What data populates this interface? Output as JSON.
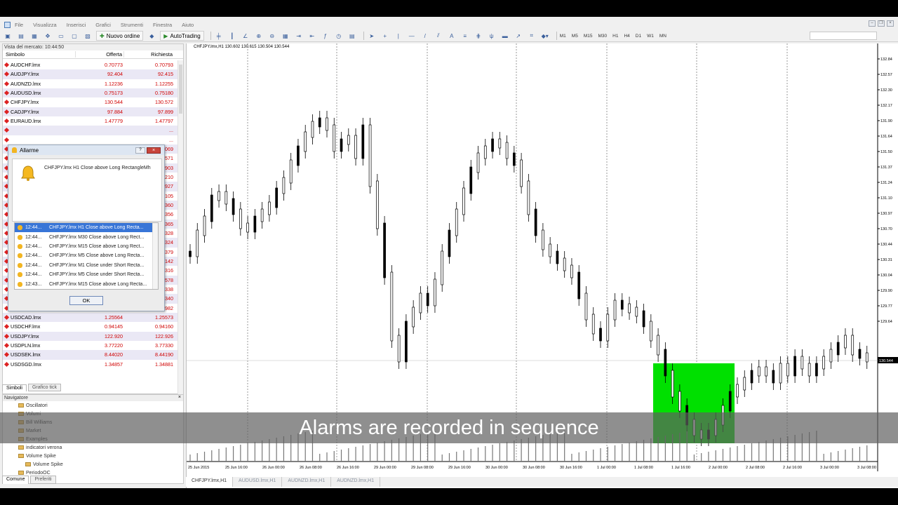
{
  "menu": [
    "File",
    "Visualizza",
    "Inserisci",
    "Grafici",
    "Strumenti",
    "Finestra",
    "Aiuto"
  ],
  "toolbar": {
    "new_order": "Nuovo ordine",
    "autotrading": "AutoTrading",
    "timeframes": [
      "M1",
      "M5",
      "M15",
      "M30",
      "H1",
      "H4",
      "D1",
      "W1",
      "MN"
    ]
  },
  "market_watch": {
    "title": "Vista del mercato: 10:44:50",
    "col_symbol": "Simbolo",
    "col_bid": "Offerta",
    "col_ask": "Richiesta",
    "rows": [
      [
        "AUDCHF.lmx",
        "0.70773",
        "0.70793"
      ],
      [
        "AUDJPY.lmx",
        "92.404",
        "92.415"
      ],
      [
        "AUDNZD.lmx",
        "1.12236",
        "1.12255"
      ],
      [
        "AUDUSD.lmx",
        "0.75173",
        "0.75180"
      ],
      [
        "CHFJPY.lmx",
        "130.544",
        "130.572"
      ],
      [
        "CADJPY.lmx",
        "97.884",
        "97.899"
      ],
      [
        "EURAUD.lmx",
        "1.47779",
        "1.47797"
      ],
      [
        "",
        "",
        "..."
      ],
      [
        "",
        "",
        "..."
      ],
      [
        "",
        "",
        "069"
      ],
      [
        "",
        "",
        "571"
      ],
      [
        "",
        "",
        "903"
      ],
      [
        "",
        "",
        "210"
      ],
      [
        "",
        "",
        "927"
      ],
      [
        "",
        "",
        "105"
      ],
      [
        "",
        "",
        "360"
      ],
      [
        "",
        "",
        "356"
      ],
      [
        "",
        "",
        "365"
      ],
      [
        "",
        "",
        "328"
      ],
      [
        "",
        "",
        "324"
      ],
      [
        "",
        "",
        "379"
      ],
      [
        "",
        "",
        "142"
      ],
      [
        "",
        "",
        "316"
      ],
      [
        "",
        "",
        "578"
      ],
      [
        "GBPUSD.lmx",
        "1.56327",
        "1.56338"
      ],
      [
        "NZDJPY.lmx",
        "82.319",
        "82.340"
      ],
      [
        "NZDUSD.lmx",
        "0.66969",
        "0.66982"
      ],
      [
        "USDCAD.lmx",
        "1.25564",
        "1.25573"
      ],
      [
        "USDCHF.lmx",
        "0.94145",
        "0.94160"
      ],
      [
        "USDJPY.lmx",
        "122.920",
        "122.926"
      ],
      [
        "USDPLN.lmx",
        "3.77220",
        "3.77330"
      ],
      [
        "USDSEK.lmx",
        "8.44020",
        "8.44190"
      ],
      [
        "USDSGD.lmx",
        "1.34857",
        "1.34881"
      ]
    ],
    "tab_symbols": "Simboli",
    "tab_tick": "Grafico tick"
  },
  "navigator": {
    "title": "Navigatore",
    "items": [
      {
        "label": "Oscillatori",
        "indent": 1
      },
      {
        "label": "Volumi",
        "indent": 1
      },
      {
        "label": "Bill Williams",
        "indent": 1
      },
      {
        "label": "Market",
        "indent": 1
      },
      {
        "label": "Examples",
        "indent": 1
      },
      {
        "label": "indicatori verona",
        "indent": 1
      },
      {
        "label": "Volume Spike",
        "indent": 1
      },
      {
        "label": "Volume Spike",
        "indent": 2
      },
      {
        "label": "PeriodoOC",
        "indent": 1
      }
    ],
    "tab_common": "Comune",
    "tab_favorites": "Preferiti"
  },
  "alarm": {
    "title": "Allarme",
    "message": "CHFJPY.lmx H1 Close above Long RectangleMh",
    "ok": "OK",
    "list": [
      [
        "12:44...",
        "CHFJPY.lmx H1 Close above Long Recta..."
      ],
      [
        "12:44...",
        "CHFJPY.lmx M30 Close above Long Rect..."
      ],
      [
        "12:44...",
        "CHFJPY.lmx M15 Close above Long Rect..."
      ],
      [
        "12:44...",
        "CHFJPY.lmx M5 Close above Long Recta..."
      ],
      [
        "12:44...",
        "CHFJPY.lmx M1 Close under Short Recta..."
      ],
      [
        "12:44...",
        "CHFJPY.lmx M5 Close under Short Recta..."
      ],
      [
        "12:43...",
        "CHFJPY.lmx M15 Close above Long Recta..."
      ]
    ]
  },
  "chart": {
    "label": "CHFJPY.lmx,H1  130.602  130.615  130.504  130.544",
    "price_ticks": [
      "132.84",
      "132.57",
      "132.30",
      "132.17",
      "131.90",
      "131.64",
      "131.50",
      "131.37",
      "131.24",
      "131.10",
      "130.97",
      "130.70",
      "130.44",
      "130.31",
      "130.04",
      "129.90",
      "129.77",
      "129.64"
    ],
    "current_price": "130.544",
    "time_ticks": [
      "25 Jun 2015",
      "25 Jun 16:00",
      "26 Jun 00:00",
      "26 Jun 08:00",
      "26 Jun 16:00",
      "29 Jun 00:00",
      "29 Jun 08:00",
      "29 Jun 16:00",
      "30 Jun 00:00",
      "30 Jun 08:00",
      "30 Jun 16:00",
      "1 Jul 00:00",
      "1 Jul 08:00",
      "1 Jul 16:00",
      "2 Jul 00:00",
      "2 Jul 08:00",
      "2 Jul 16:00",
      "3 Jul 00:00",
      "3 Jul 08:00"
    ],
    "tabs": [
      "CHFJPY.lmx,H1",
      "AUDUSD.lmx,H1",
      "AUDNZD.lmx,H1",
      "AUDNZD.lmx,H1"
    ],
    "rect_color": "#00e000"
  },
  "subtitle": "Alarms are recorded in sequence"
}
